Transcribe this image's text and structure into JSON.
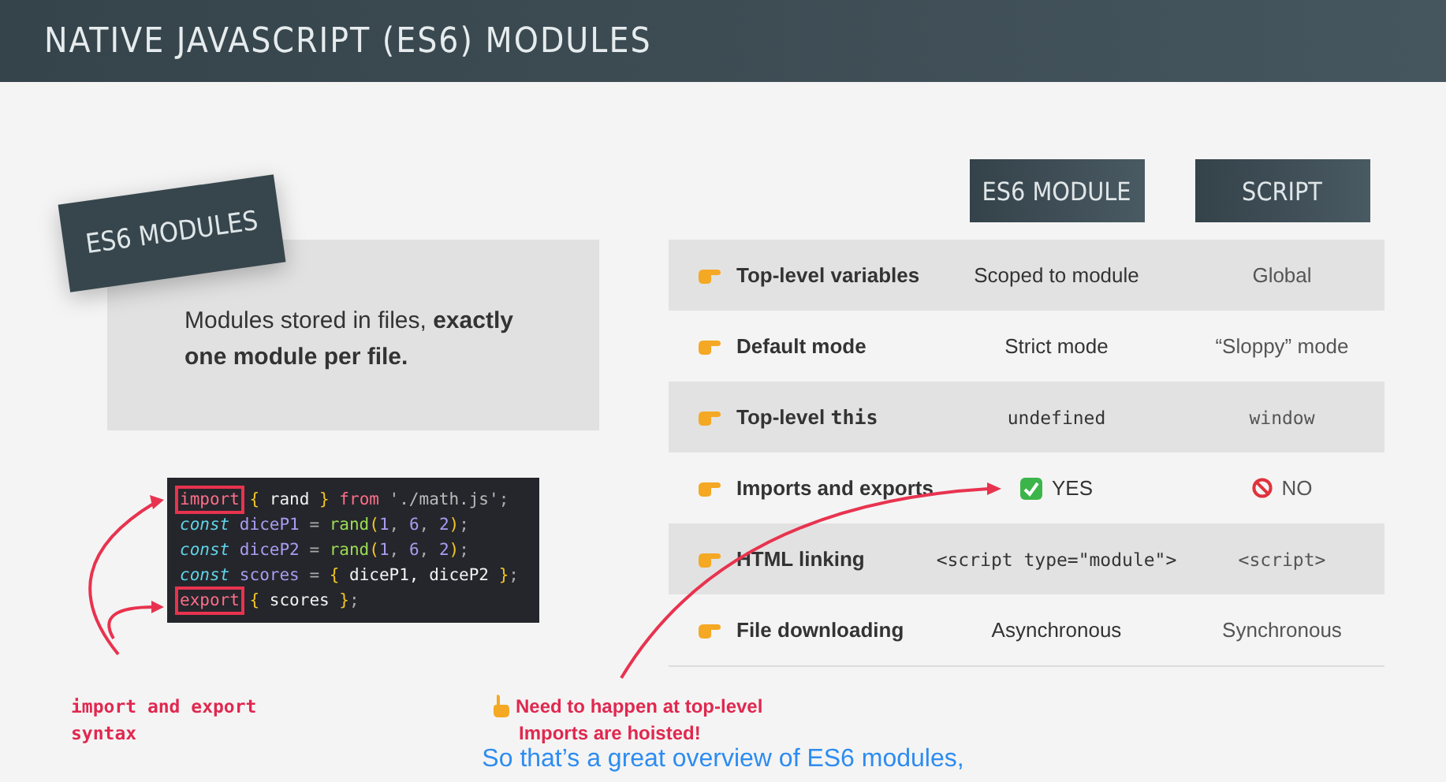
{
  "header": {
    "title": "NATIVE JAVASCRIPT (ES6) MODULES"
  },
  "concept": {
    "tag": "ES6 MODULES",
    "text": "Modules stored in files, **exactly one module per file.**"
  },
  "code": [
    [
      {
        "kind": "boxed_keyword",
        "text": "import"
      },
      {
        "kind": "brace",
        "text": " { "
      },
      {
        "kind": "plain",
        "text": "rand"
      },
      {
        "kind": "brace",
        "text": " } "
      },
      {
        "kind": "keyword",
        "text": "from"
      },
      {
        "kind": "string",
        "text": " './math.js'"
      },
      {
        "kind": "punct",
        "text": ";"
      }
    ],
    [
      {
        "kind": "decl",
        "text": "const"
      },
      {
        "kind": "name",
        "text": " diceP1 "
      },
      {
        "kind": "punct",
        "text": "= "
      },
      {
        "kind": "func",
        "text": "rand"
      },
      {
        "kind": "brace",
        "text": "("
      },
      {
        "kind": "number",
        "text": "1"
      },
      {
        "kind": "punct",
        "text": ", "
      },
      {
        "kind": "number",
        "text": "6"
      },
      {
        "kind": "punct",
        "text": ", "
      },
      {
        "kind": "number",
        "text": "2"
      },
      {
        "kind": "brace",
        "text": ")"
      },
      {
        "kind": "punct",
        "text": ";"
      }
    ],
    [
      {
        "kind": "decl",
        "text": "const"
      },
      {
        "kind": "name",
        "text": " diceP2 "
      },
      {
        "kind": "punct",
        "text": "= "
      },
      {
        "kind": "func",
        "text": "rand"
      },
      {
        "kind": "brace",
        "text": "("
      },
      {
        "kind": "number",
        "text": "1"
      },
      {
        "kind": "punct",
        "text": ", "
      },
      {
        "kind": "number",
        "text": "6"
      },
      {
        "kind": "punct",
        "text": ", "
      },
      {
        "kind": "number",
        "text": "2"
      },
      {
        "kind": "brace",
        "text": ")"
      },
      {
        "kind": "punct",
        "text": ";"
      }
    ],
    [
      {
        "kind": "decl",
        "text": "const"
      },
      {
        "kind": "name",
        "text": " scores "
      },
      {
        "kind": "punct",
        "text": "= "
      },
      {
        "kind": "brace",
        "text": "{ "
      },
      {
        "kind": "plain",
        "text": "diceP1, diceP2 "
      },
      {
        "kind": "brace",
        "text": "}"
      },
      {
        "kind": "punct",
        "text": ";"
      }
    ],
    [
      {
        "kind": "boxed_keyword",
        "text": "export"
      },
      {
        "kind": "brace",
        "text": " { "
      },
      {
        "kind": "plain",
        "text": "scores"
      },
      {
        "kind": "brace",
        "text": " }"
      },
      {
        "kind": "punct",
        "text": ";"
      }
    ]
  ],
  "code_note": "import and export syntax",
  "columns": [
    "ES6 MODULE",
    "SCRIPT"
  ],
  "rows": [
    {
      "label": "Top-level variables",
      "values": [
        {
          "kind": "text",
          "text": "Scoped to module"
        },
        {
          "kind": "text",
          "text": "Global"
        }
      ]
    },
    {
      "label": "Default mode",
      "values": [
        {
          "kind": "text",
          "text": "Strict mode"
        },
        {
          "kind": "text",
          "text": "“Sloppy” mode"
        }
      ]
    },
    {
      "label": "Top-level",
      "label_code": "this",
      "values": [
        {
          "kind": "code",
          "text": "undefined"
        },
        {
          "kind": "code",
          "text": "window"
        }
      ]
    },
    {
      "label": "Imports and exports",
      "values": [
        {
          "kind": "yes",
          "text": "YES"
        },
        {
          "kind": "no",
          "text": "NO"
        }
      ]
    },
    {
      "label": "HTML linking",
      "values": [
        {
          "kind": "code",
          "text": "<script type=\"module\">"
        },
        {
          "kind": "code",
          "text": "<script>"
        }
      ]
    },
    {
      "label": "File downloading",
      "values": [
        {
          "kind": "text",
          "text": "Asynchronous"
        },
        {
          "kind": "text",
          "text": "Synchronous"
        }
      ]
    }
  ],
  "notes": [
    "Need to happen at top-level",
    "Imports are hoisted!"
  ],
  "subtitle": "So that’s a great overview of ES6 modules,"
}
